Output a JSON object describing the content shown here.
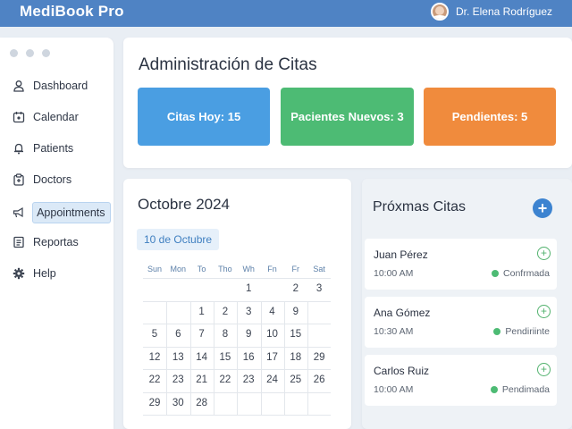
{
  "header": {
    "app_title": "MediBook Pro",
    "user_name": "Dr. Elena Rodríguez"
  },
  "sidebar": {
    "items": [
      {
        "label": "Dashboard",
        "icon": "user-icon"
      },
      {
        "label": "Calendar",
        "icon": "calendar-icon"
      },
      {
        "label": "Patients",
        "icon": "bell-icon"
      },
      {
        "label": "Doctors",
        "icon": "clipboard-icon"
      },
      {
        "label": "Appointments",
        "icon": "megaphone-icon",
        "active": true
      },
      {
        "label": "Reportas",
        "icon": "document-icon"
      },
      {
        "label": "Help",
        "icon": "gear-icon"
      }
    ]
  },
  "admin": {
    "title": "Administración de Citas",
    "stats": [
      {
        "label": "Citas Hoy: 15",
        "color": "#4a9ee2"
      },
      {
        "label": "Pacientes Nuevos: 3",
        "color": "#4dbb74"
      },
      {
        "label": "Pendientes: 5",
        "color": "#f08b3d"
      }
    ]
  },
  "calendar": {
    "month_title": "Octobre 2024",
    "selected_date": "10 de Octubre",
    "weekdays": [
      "Sun",
      "Mon",
      "To",
      "Tho",
      "Wh",
      "Fn",
      "Fr",
      "Sat"
    ],
    "weeks": [
      [
        "",
        "",
        "",
        "",
        "1",
        "",
        "2",
        "3"
      ],
      [
        "",
        "",
        "1",
        "2",
        "3",
        "4",
        "9",
        ""
      ],
      [
        "5",
        "6",
        "7",
        "8",
        "9",
        "10",
        "15",
        ""
      ],
      [
        "12",
        "13",
        "14",
        "15",
        "16",
        "17",
        "18",
        "29"
      ],
      [
        "22",
        "23",
        "21",
        "22",
        "23",
        "24",
        "25",
        "26"
      ],
      [
        "29",
        "30",
        "28",
        "",
        "",
        "",
        "",
        ""
      ]
    ]
  },
  "upcoming": {
    "title": "Próxmas Citas",
    "add_label": "+",
    "appointments": [
      {
        "name": "Juan Pérez",
        "time": "10:00 AM",
        "status": "Confrmada"
      },
      {
        "name": "Ana Gómez",
        "time": "10:30 AM",
        "status": "Pendiriinte"
      },
      {
        "name": "Carlos Ruiz",
        "time": "10:00 AM",
        "status": "Pendimada"
      }
    ],
    "status_color": "#4dbb74"
  }
}
